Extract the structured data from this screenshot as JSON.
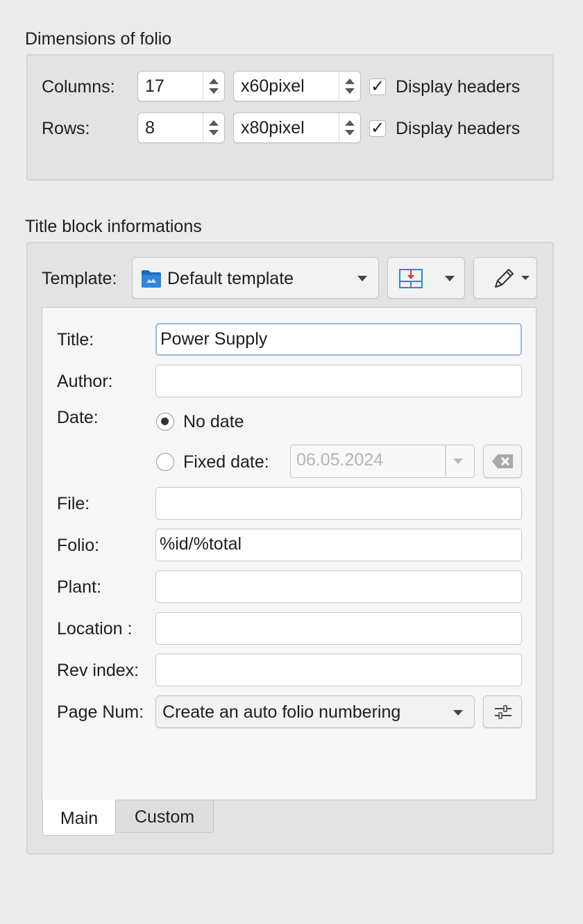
{
  "dimensions": {
    "section_title": "Dimensions of folio",
    "columns_label": "Columns:",
    "columns_value": "17",
    "columns_size": "x60pixel",
    "rows_label": "Rows:",
    "rows_value": "8",
    "rows_size": "x80pixel",
    "display_headers_label": "Display headers",
    "columns_headers_checked": "✓",
    "rows_headers_checked": "✓"
  },
  "title_block": {
    "section_title": "Title block informations",
    "template_label": "Template:",
    "template_value": "Default template",
    "template_icon": "folder-icon",
    "fields": {
      "title_label": "Title:",
      "title_value": "Power Supply",
      "author_label": "Author:",
      "author_value": "",
      "date_label": "Date:",
      "no_date_label": "No date",
      "fixed_date_label": "Fixed date:",
      "fixed_date_value": "06.05.2024",
      "file_label": "File:",
      "file_value": "",
      "folio_label": "Folio:",
      "folio_value": "%id/%total",
      "plant_label": "Plant:",
      "plant_value": "",
      "location_label": "Location :",
      "location_value": "",
      "rev_index_label": "Rev index:",
      "rev_index_value": "",
      "page_num_label": "Page Num:",
      "page_num_value": "Create an auto folio numbering"
    },
    "tabs": [
      "Main",
      "Custom"
    ],
    "selected_tab": "Main",
    "date_mode": "no_date"
  },
  "colors": {
    "window_bg": "#ececec",
    "group_bg": "#e3e3e3",
    "panel_bg": "#f6f6f6",
    "focus_border": "#9bb7e3",
    "folder_icon": "#1a6fc1",
    "disabled_text": "#b5b5b5"
  }
}
